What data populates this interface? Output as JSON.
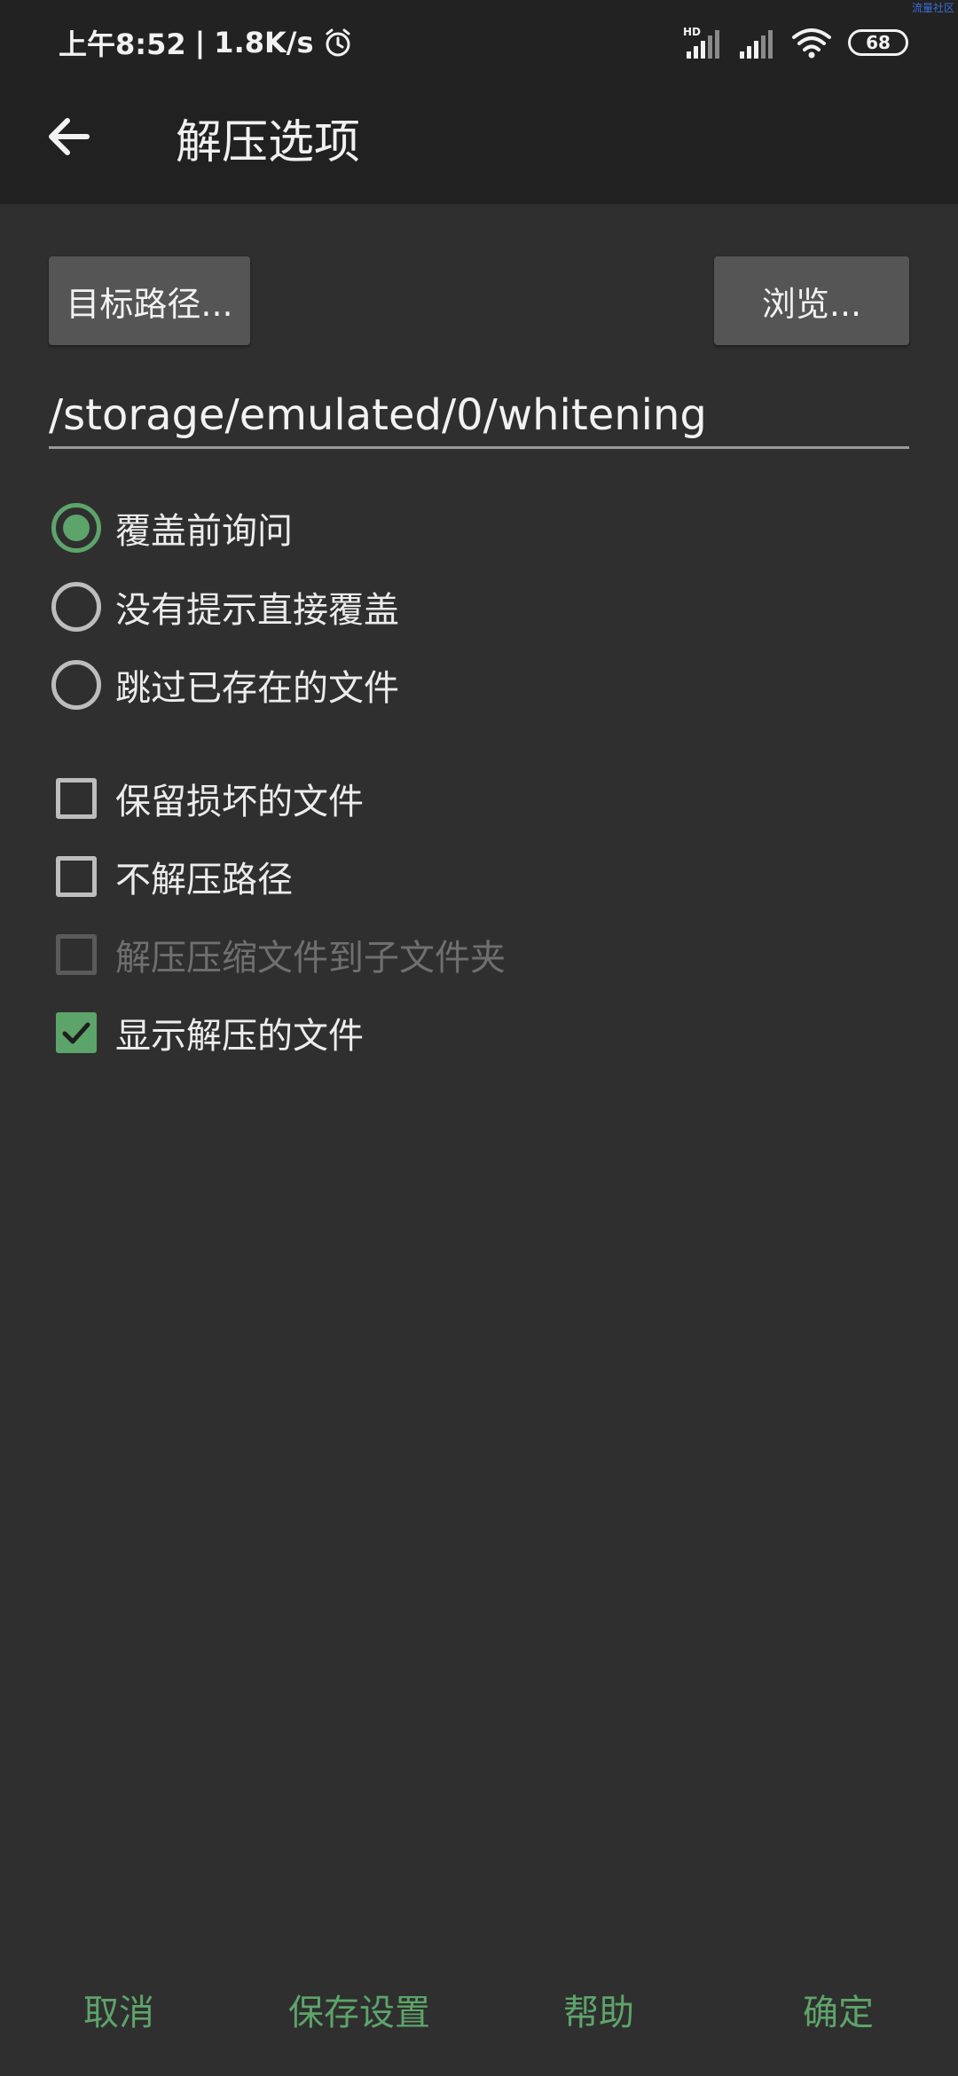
{
  "status_bar": {
    "time": "上午8:52",
    "net_speed": "1.8K/s",
    "separator": "|",
    "hd_label": "HD",
    "battery": "68",
    "watermark": "流量社区"
  },
  "app_bar": {
    "title": "解压选项"
  },
  "destination": {
    "target_label": "目标路径...",
    "browse_label": "浏览...",
    "path_value": "/storage/emulated/0/whitening"
  },
  "overwrite_options": [
    {
      "label": "覆盖前询问",
      "checked": true
    },
    {
      "label": "没有提示直接覆盖",
      "checked": false
    },
    {
      "label": "跳过已存在的文件",
      "checked": false
    }
  ],
  "checkbox_options": [
    {
      "label": "保留损坏的文件",
      "checked": false,
      "enabled": true
    },
    {
      "label": "不解压路径",
      "checked": false,
      "enabled": true
    },
    {
      "label": "解压压缩文件到子文件夹",
      "checked": false,
      "enabled": false
    },
    {
      "label": "显示解压的文件",
      "checked": true,
      "enabled": true
    }
  ],
  "actions": {
    "cancel": "取消",
    "save_settings": "保存设置",
    "help": "帮助",
    "ok": "确定"
  },
  "colors": {
    "accent": "#5da46a",
    "background": "#2f2f2f",
    "app_bar": "#212121"
  }
}
